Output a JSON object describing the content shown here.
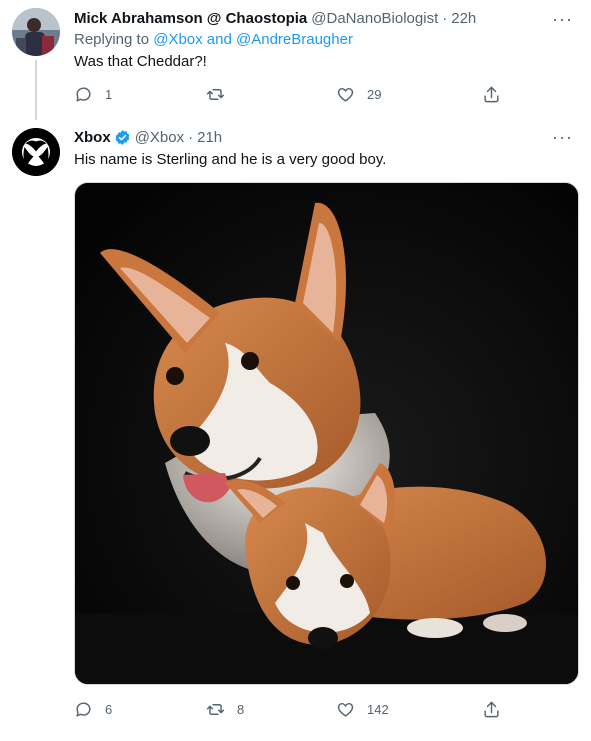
{
  "tweet1": {
    "name": "Mick Abrahamson @ Chaostopia",
    "handle": "@DaNanoBiologist",
    "separator": "·",
    "time": "22h",
    "replying_prefix": "Replying to",
    "replying_to": "@Xbox and @AndreBraugher",
    "text": "Was that Cheddar?!",
    "reply_count": "1",
    "retweet_count": "",
    "like_count": "29",
    "more": "···"
  },
  "tweet2": {
    "name": "Xbox",
    "handle": "@Xbox",
    "separator": "·",
    "time": "21h",
    "text": "His name is Sterling and he is a very good boy.",
    "reply_count": "6",
    "retweet_count": "8",
    "like_count": "142",
    "more": "···",
    "media_subject": "two corgi dogs on black background"
  },
  "colors": {
    "link": "#1d9bf0",
    "muted": "#536471",
    "verified": "#1d9bf0"
  }
}
